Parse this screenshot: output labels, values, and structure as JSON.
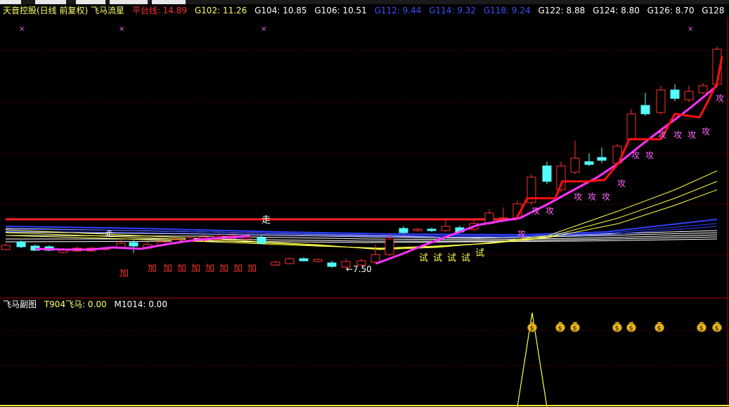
{
  "header": {
    "title": "天音控股(日线 前复权) 飞马流星",
    "items": [
      {
        "text": "平台线: 14.89",
        "color": "#ff3030"
      },
      {
        "text": "G102: 11.26",
        "color": "#ffff66"
      },
      {
        "text": "G104: 10.85",
        "color": "#ffffff"
      },
      {
        "text": "G106: 10.51",
        "color": "#ffffff"
      },
      {
        "text": "G112: 9.44",
        "color": "#3a50ff"
      },
      {
        "text": "G114: 9.32",
        "color": "#3a50ff"
      },
      {
        "text": "G118: 9.24",
        "color": "#3a50ff"
      },
      {
        "text": "G122: 8.88",
        "color": "#ffffff"
      },
      {
        "text": "G124: 8.80",
        "color": "#ffffff"
      },
      {
        "text": "G126: 8.70",
        "color": "#ffffff"
      },
      {
        "text": "G128",
        "color": "#ffffff"
      }
    ]
  },
  "sub_header": {
    "title": "飞马副图",
    "items": [
      {
        "text": "T904飞马: 0.00",
        "color": "#ffff66"
      },
      {
        "text": "M1014: 0.00",
        "color": "#ffffff"
      }
    ]
  },
  "annotations": {
    "zou": "走",
    "jia": "加",
    "shi": "试",
    "gong": "攻",
    "low_price": "←7.50",
    "x_mark": "×"
  },
  "icons": {
    "money_bag": "money-bag-icon"
  },
  "colors": {
    "up": "#ff3030",
    "down": "#54ffff",
    "platform": "#ff2020",
    "trend_magenta": "#ff33ff",
    "trend_red": "#ff1010",
    "yellow": "#ffff44",
    "blue": "#3040ff",
    "gong_text": "#ff66ff",
    "jia_text": "#ff3030",
    "shi_text": "#ffff44",
    "grid": "#8b0000"
  }
}
